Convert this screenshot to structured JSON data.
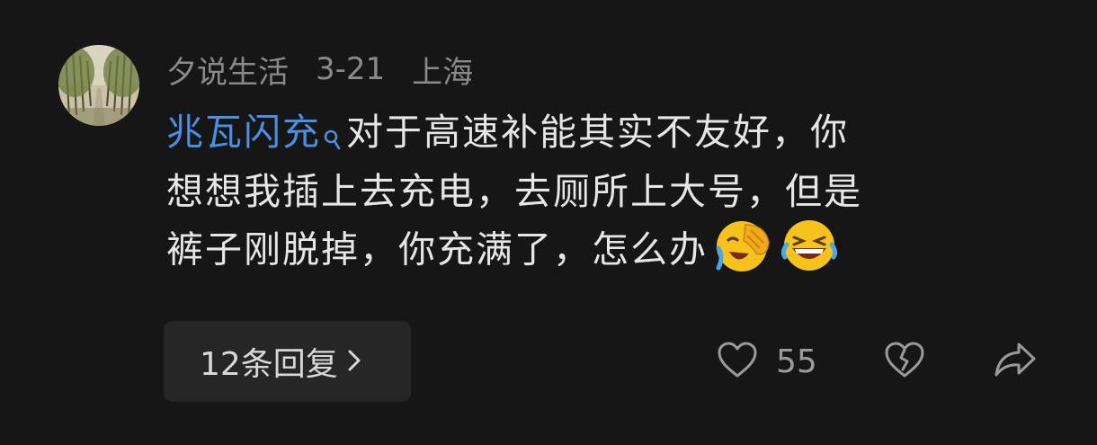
{
  "comment": {
    "username": "夕说生活",
    "date": "3-21",
    "location": "上海",
    "link_text": "兆瓦闪充",
    "link_icon": "search-icon",
    "line1": "对于高速补能其实不友好，你",
    "line2": "想想我插上去充电，去厕所上大号，但是",
    "line3": "裤子刚脱掉，你充满了，怎么办",
    "emojis": [
      "face-with-hand-over-mouth-laughing-emoji",
      "grinning-squinting-face-emoji"
    ]
  },
  "replies": {
    "label": "12条回复",
    "icon": "chevron-right-icon"
  },
  "actions": {
    "like_icon": "heart-icon",
    "like_count": "55",
    "dislike_icon": "broken-heart-icon",
    "share_icon": "share-icon"
  },
  "colors": {
    "background": "#161616",
    "link": "#4a90e2",
    "meta": "#8a8a8a",
    "button_bg": "#262626"
  }
}
